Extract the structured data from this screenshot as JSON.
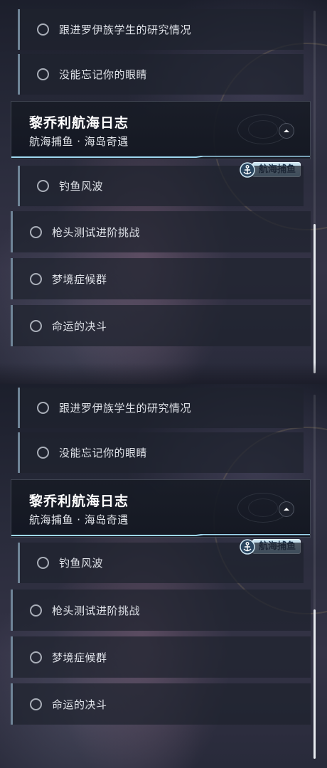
{
  "quest_list": {
    "sub_quests_before": [
      {
        "label": "跟进罗伊族学生的研究情况"
      },
      {
        "label": "没能忘记你的眼睛"
      }
    ],
    "expanded_group": {
      "title": "黎乔利航海日志",
      "subtitle": "航海捕鱼 · 海岛奇遇",
      "tag_label": "航海捕鱼",
      "collapse_icon": "chevron-up-icon",
      "accent_color": "#9fd8ef"
    },
    "group_children": [
      {
        "label": "钓鱼风波"
      }
    ],
    "quests_after": [
      {
        "label": "枪头测试进阶挑战"
      },
      {
        "label": "梦境症候群"
      },
      {
        "label": "命运的决斗"
      }
    ]
  },
  "scroll": {
    "position": 0.65
  },
  "colors": {
    "accent_bar": "#6f8497",
    "tag_background": "#a8cfe2",
    "panel_background": "#222634"
  }
}
